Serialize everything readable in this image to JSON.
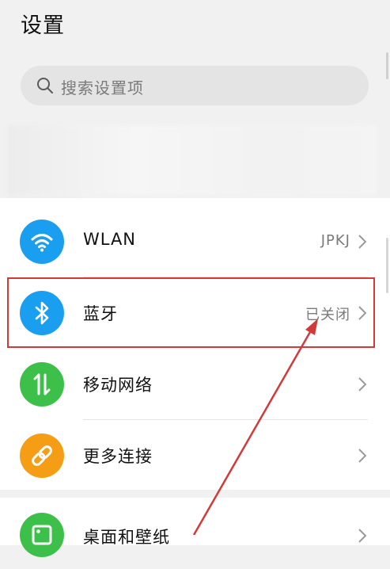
{
  "header": {
    "title": "设置"
  },
  "search": {
    "placeholder": "搜索设置项"
  },
  "settings": [
    {
      "label": "WLAN",
      "value": "JPKJ",
      "icon": "wifi-icon",
      "color": "#1a9ef0"
    },
    {
      "label": "蓝牙",
      "value": "已关闭",
      "icon": "bluetooth-icon",
      "color": "#1a9ef0"
    },
    {
      "label": "移动网络",
      "value": "",
      "icon": "mobile-data-icon",
      "color": "#3cc049"
    },
    {
      "label": "更多连接",
      "value": "",
      "icon": "link-icon",
      "color": "#f59d15"
    }
  ],
  "next_section": {
    "label": "桌面和壁纸",
    "icon": "wallpaper-icon",
    "color": "#3cc049"
  },
  "annotation": {
    "color": "#d23a3a"
  }
}
